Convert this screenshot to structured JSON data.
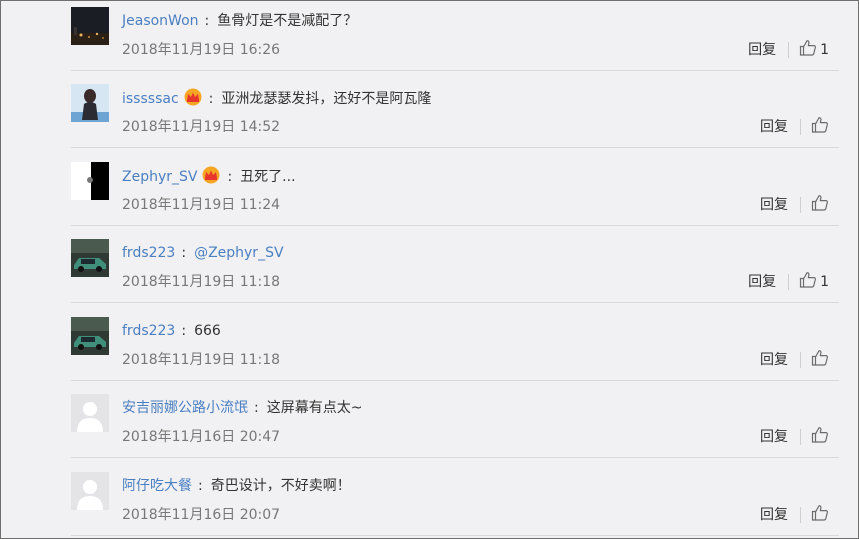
{
  "comments": [
    {
      "user": "JeasonWon",
      "crown": false,
      "text": "鱼骨灯是不是减配了？",
      "mention": "",
      "time": "2018年11月19日 16:26",
      "reply": "回复",
      "likes": "1",
      "avatar": "dark-night"
    },
    {
      "user": "isssssac",
      "crown": true,
      "text": "亚洲龙瑟瑟发抖，还好不是阿瓦隆",
      "mention": "",
      "time": "2018年11月19日 14:52",
      "reply": "回复",
      "likes": "",
      "avatar": "person-blue"
    },
    {
      "user": "Zephyr_SV",
      "crown": true,
      "text": "丑死了...",
      "mention": "",
      "time": "2018年11月19日 11:24",
      "reply": "回复",
      "likes": "",
      "avatar": "black-white"
    },
    {
      "user": "frds223",
      "crown": false,
      "text": "",
      "mention": "@Zephyr_SV",
      "time": "2018年11月19日 11:18",
      "reply": "回复",
      "likes": "1",
      "avatar": "green-car"
    },
    {
      "user": "frds223",
      "crown": false,
      "text": "666",
      "mention": "",
      "time": "2018年11月19日 11:18",
      "reply": "回复",
      "likes": "",
      "avatar": "green-car"
    },
    {
      "user": "安吉丽娜公路小流氓",
      "crown": false,
      "text": "这屏幕有点太~",
      "mention": "",
      "time": "2018年11月16日 20:47",
      "reply": "回复",
      "likes": "",
      "avatar": "default"
    },
    {
      "user": "阿仔吃大餐",
      "crown": false,
      "text": "奇巴设计，不好卖啊！",
      "mention": "",
      "time": "2018年11月16日 20:07",
      "reply": "回复",
      "likes": "",
      "avatar": "default"
    }
  ],
  "colors": {
    "username": "#4a7fc1",
    "text": "#333333",
    "time": "#777777",
    "background": "#f1f1f3",
    "crown": "#f5a623"
  },
  "icons": {
    "like": "thumbs-up-icon",
    "crown": "crown-icon"
  }
}
